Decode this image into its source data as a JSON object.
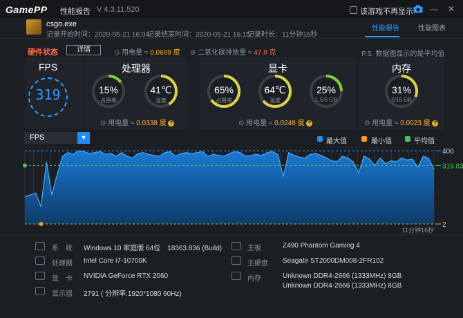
{
  "titlebar": {
    "logo": "GamePP",
    "report_title": "性能报告",
    "version": "V 4.3.11.520",
    "hide_label": "该游戏不再显示"
  },
  "game": {
    "name": "csgo.exe",
    "start": "记录开始时间：2020-05-21 16:04",
    "end": "记录结束时间：2020-05-21 16:15",
    "duration": "记录时长：11分钟16秒"
  },
  "tabs": [
    "性能报告",
    "性能图表"
  ],
  "status": {
    "title": "硬件状态",
    "detail_button": "详情",
    "power_label": "用电量 ≈ ",
    "power_value": "0.0609 度",
    "co2_label": "二氧化碳排放量 ≈ ",
    "co2_value": "47.8 克",
    "note": "P.S. 数据图显示的是平均值"
  },
  "fps": {
    "title": "FPS",
    "value": "319"
  },
  "cpu": {
    "title": "处理器",
    "usage": "15%",
    "usage_label": "占用率",
    "usage_fraction": 0.15,
    "temp": "41℃",
    "temp_label": "温度",
    "temp_fraction": 0.41,
    "power_label": "用电量 ≈ ",
    "power_value": "0.0338 度"
  },
  "gpu": {
    "title": "显卡",
    "usage": "65%",
    "usage_label": "占用率",
    "usage_fraction": 0.65,
    "temp": "64℃",
    "temp_label": "温度",
    "temp_fraction": 0.64,
    "vram": "25%",
    "vram_label": "1.5/6 GB",
    "vram_fraction": 0.25,
    "power_label": "用电量 ≈ ",
    "power_value": "0.0248 度"
  },
  "memory": {
    "title": "内存",
    "usage": "31%",
    "usage_label": "5/16 GB",
    "usage_fraction": 0.31,
    "power_label": "用电量 ≈ ",
    "power_value": "0.0023 度"
  },
  "chart_controls": {
    "selected": "FPS",
    "legend": [
      "最大值",
      "最小值",
      "平均值"
    ]
  },
  "colors": {
    "accent": "#2e9bff",
    "max": "#1f8ef0",
    "min": "#f0a020",
    "avg": "#4cc25a",
    "gauge_green": "#7dcf3a",
    "gauge_yellow": "#d9d24a"
  },
  "chart_data": {
    "type": "area",
    "series": [
      {
        "values": [
          150,
          160,
          170,
          95,
          340,
          160,
          270,
          370,
          390,
          380,
          400,
          395,
          385,
          390,
          395,
          380,
          385,
          370,
          390,
          370,
          360,
          385,
          390,
          380,
          375,
          370,
          390,
          395,
          370,
          385,
          390,
          385,
          390,
          395,
          370,
          380,
          375,
          370,
          385,
          395,
          390,
          370,
          375,
          380,
          375,
          390,
          395,
          380,
          260,
          390,
          375,
          365,
          360,
          380,
          385,
          375,
          360,
          345,
          340,
          370,
          360,
          340,
          280,
          370,
          355,
          320,
          360,
          330,
          345,
          340,
          360,
          350,
          355,
          310,
          370,
          360,
          300
        ]
      }
    ],
    "max": 400,
    "min": 2,
    "avg": 319.83,
    "ylim": [
      2,
      400
    ],
    "max_label": "400",
    "min_label": "2",
    "avg_label": "319.83",
    "duration_label": "11分钟16秒"
  },
  "sysinfo": {
    "left": [
      {
        "label": "系　统",
        "value": "Windows 10 家庭版 64位　18363.836 (Build)"
      },
      {
        "label": "处理器",
        "value": "Intel Core i7-10700K"
      },
      {
        "label": "显　卡",
        "value": "NVIDIA GeForce RTX 2060"
      },
      {
        "label": "显示器",
        "value": "2791 ( 分辨率:1920*1080 60Hz)"
      }
    ],
    "right": [
      {
        "label": "主板",
        "value": "Z490 Phantom Gaming 4"
      },
      {
        "label": "主硬盘",
        "value": "Seagate ST2000DM008-2FR102"
      },
      {
        "label": "内存",
        "value": "Unknown DDR4-2666 (1333MHz) 8GB"
      },
      {
        "label": "",
        "value": "Unknown DDR4-2666 (1333MHz) 8GB"
      }
    ]
  }
}
